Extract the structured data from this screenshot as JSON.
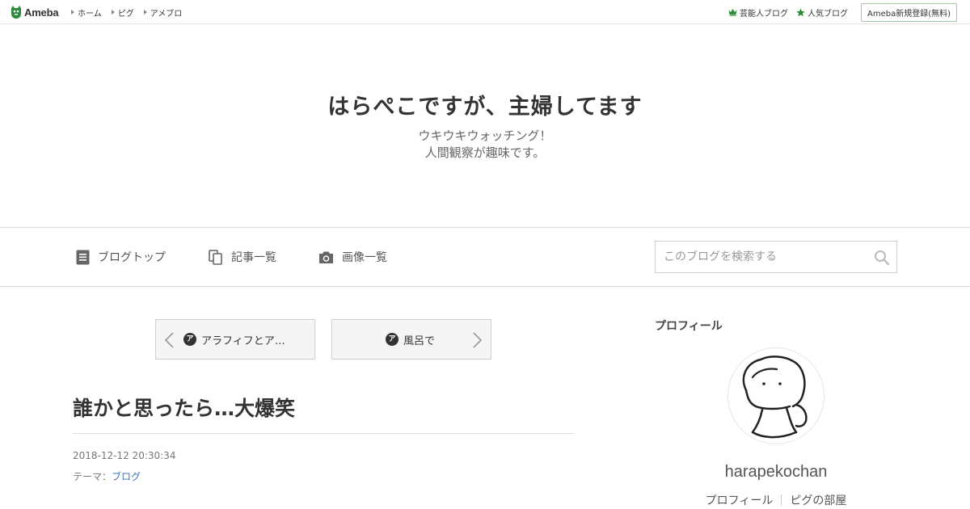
{
  "topbar": {
    "logo": "Ameba",
    "nav": [
      "ホーム",
      "ピグ",
      "アメブロ"
    ],
    "celebrity_blog": "芸能人ブログ",
    "popular_blog": "人気ブログ",
    "register": "Ameba新規登録(無料)"
  },
  "header": {
    "title": "はらぺこですが、主婦してます",
    "desc_line1": "ウキウキウォッチング！",
    "desc_line2": "人間観察が趣味です。"
  },
  "nav": {
    "blog_top": "ブログトップ",
    "entry_list": "記事一覧",
    "image_list": "画像一覧",
    "search_placeholder": "このブログを検索する"
  },
  "pager": {
    "prev_title": "アラフィフとア…",
    "next_title": "風呂で",
    "badge": "ア"
  },
  "entry": {
    "title": "誰かと思ったら…大爆笑",
    "date": "2018-12-12 20:30:34",
    "theme_label": "テーマ：",
    "theme": "ブログ"
  },
  "sidebar": {
    "heading": "プロフィール",
    "username": "harapekochan",
    "profile_link": "プロフィール",
    "pig_room_link": "ピグの部屋"
  },
  "colors": {
    "brand_green": "#2d8c3c",
    "link_blue": "#3b73b9"
  }
}
